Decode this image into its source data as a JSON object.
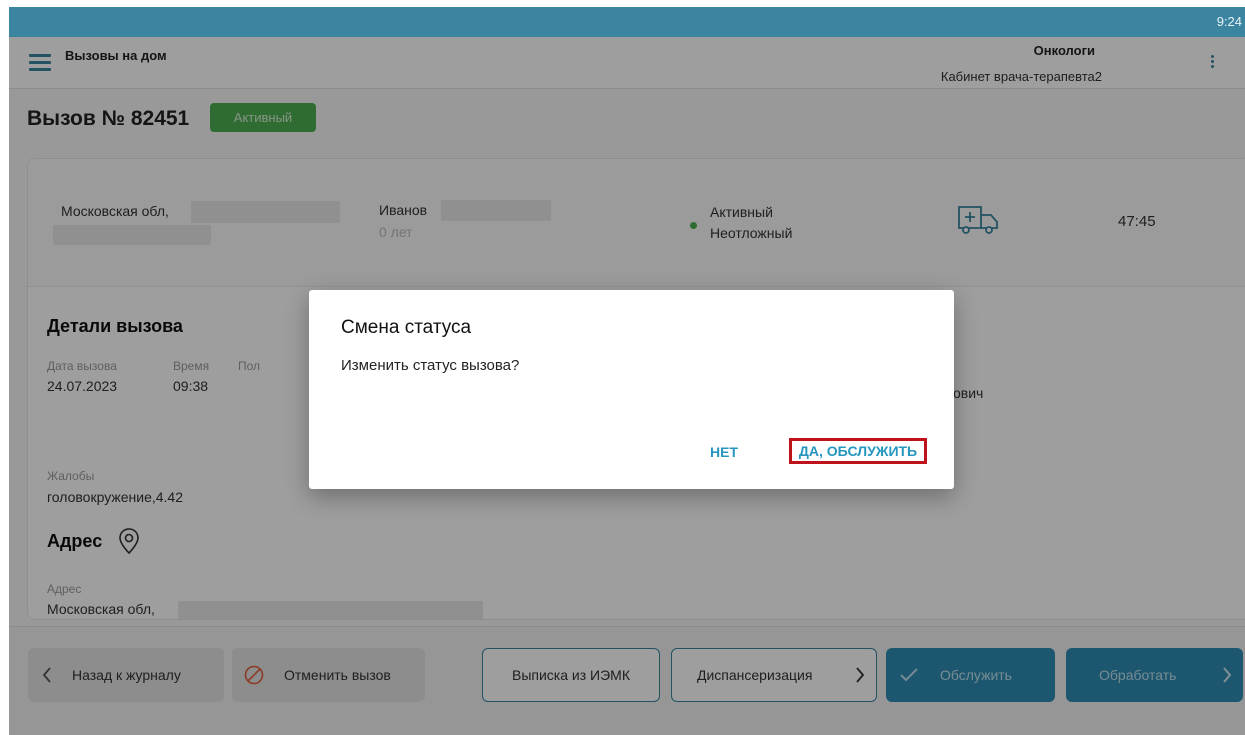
{
  "status_bar": {
    "time": "9:24"
  },
  "header": {
    "title": "Вызовы на дом",
    "org": "Онкологи",
    "cabinet": "Кабинет врача-терапевта2"
  },
  "call": {
    "title": "Вызов № 82451",
    "badge": "Активный"
  },
  "summary": {
    "address": "Московская обл,",
    "patient": "Иванов",
    "age": "0 лет",
    "status": "Активный",
    "urgency": "Неотложный",
    "timer": "47:45"
  },
  "details": {
    "title": "Детали вызова",
    "date_label": "Дата вызова",
    "date_value": "24.07.2023",
    "time_label": "Время",
    "time_value": "09:38",
    "sex_label": "Пол",
    "doctor_partial": "ович",
    "complaints_label": "Жалобы",
    "complaints_value": "головокружение,4.42"
  },
  "address_section": {
    "title": "Адрес",
    "label": "Адрес",
    "value": "Московская обл,"
  },
  "bottom": {
    "back": "Назад к журналу",
    "cancel": "Отменить вызов",
    "extract": "Выписка из ИЭМК",
    "dispensary": "Диспансеризация",
    "serve": "Обслужить",
    "process": "Обработать"
  },
  "dialog": {
    "title": "Смена статуса",
    "message": "Изменить статус вызова?",
    "no": "НЕТ",
    "yes": "ДА, ОБСЛУЖИТЬ"
  },
  "colors": {
    "primary": "#3b85a1",
    "active_green": "#4caf50",
    "link_blue": "#2596be",
    "highlight_red": "#c0121a"
  }
}
